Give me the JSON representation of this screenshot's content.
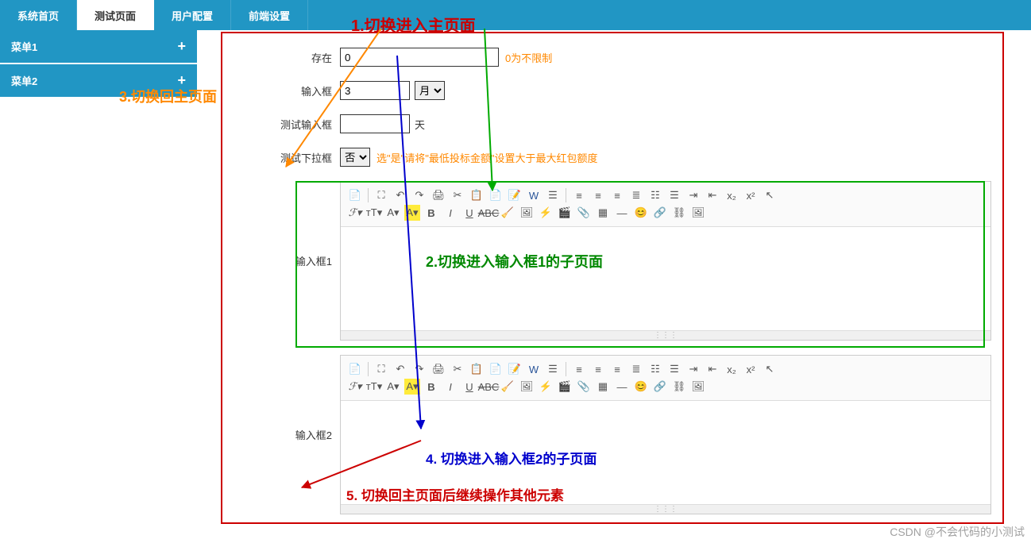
{
  "topnav": {
    "tabs": [
      "系统首页",
      "测试页面",
      "用户配置",
      "前端设置"
    ],
    "active_index": 1
  },
  "sidebar": {
    "items": [
      {
        "label": "菜单1",
        "expand": "+"
      },
      {
        "label": "菜单2",
        "expand": "+"
      }
    ]
  },
  "form": {
    "exists": {
      "label": "存在",
      "value": "0",
      "hint": "0为不限制"
    },
    "input_box": {
      "label": "输入框",
      "value": "3",
      "unit_options": [
        "月"
      ],
      "unit_selected": "月"
    },
    "test_input": {
      "label": "测试输入框",
      "value": "",
      "after": "天"
    },
    "test_select": {
      "label": "测试下拉框",
      "options": [
        "否"
      ],
      "selected": "否",
      "hint": "选\"是\"请将\"最低投标金额\"设置大于最大红包额度"
    },
    "editor1": {
      "label": "输入框1"
    },
    "editor2": {
      "label": "输入框2"
    }
  },
  "annotations": {
    "a1": "1.切换进入主页面",
    "a2": "2.切换进入输入框1的子页面",
    "a3": "3.切换回主页面",
    "a4": "4. 切换进入输入框2的子页面",
    "a5": "5. 切换回主页面后继续操作其他元素"
  },
  "watermark": "CSDN @不会代码的小测试",
  "toolbar_icons_row1": [
    "source",
    "fullscreen",
    "undo",
    "redo",
    "print",
    "cut",
    "copy",
    "paste",
    "paste-text",
    "paste-word",
    "select-all",
    "align-left",
    "align-center",
    "align-right",
    "justify",
    "list-ol",
    "list-ul",
    "indent",
    "outdent",
    "sub",
    "sup",
    "cursor"
  ],
  "toolbar_icons_row2": [
    "font-family",
    "font-size",
    "font-color",
    "bg-color",
    "bold",
    "italic",
    "underline",
    "strike",
    "clear-format",
    "image",
    "flash",
    "media",
    "attach",
    "table",
    "hr",
    "emoji",
    "link",
    "unlink",
    "fullpage"
  ]
}
